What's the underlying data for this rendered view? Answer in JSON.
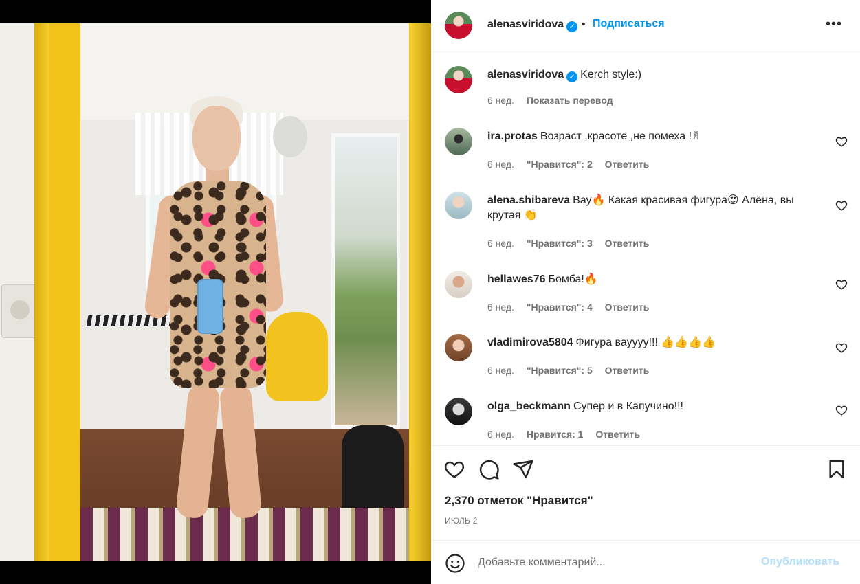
{
  "post": {
    "author": "alenasviridova",
    "follow_label": "Подписаться",
    "dot_separator": "•",
    "more_label": "•••",
    "caption": "Kerch style:)",
    "caption_time": "6 нед.",
    "translate_label": "Показать перевод"
  },
  "comments": [
    {
      "user": "ira.protas",
      "text": "Возраст ,красоте ,не помеха !✌",
      "time": "6 нед.",
      "likes": "\"Нравится\": 2",
      "reply": "Ответить"
    },
    {
      "user": "alena.shibareva",
      "text": "Вау🔥 Какая красивая фигура😍 Алёна, вы крутая 👏",
      "time": "6 нед.",
      "likes": "\"Нравится\": 3",
      "reply": "Ответить"
    },
    {
      "user": "hellawes76",
      "text": "Бомба!🔥",
      "time": "6 нед.",
      "likes": "\"Нравится\": 4",
      "reply": "Ответить"
    },
    {
      "user": "vladimirova5804",
      "text": "Фигура вауууу!!! 👍👍👍👍",
      "time": "6 нед.",
      "likes": "\"Нравится\": 5",
      "reply": "Ответить"
    },
    {
      "user": "olga_beckmann",
      "text": "Супер и в Капучино!!!",
      "time": "6 нед.",
      "likes": "Нравится: 1",
      "reply": "Ответить"
    }
  ],
  "actions": {
    "likes_count": "2,370 отметок \"Нравится\"",
    "date": "ИЮЛЬ 2"
  },
  "comment_form": {
    "placeholder": "Добавьте комментарий...",
    "publish_label": "Опубликовать"
  },
  "icons": [
    "heart-icon",
    "comment-icon",
    "share-icon",
    "bookmark-icon",
    "emoji-icon",
    "verified-icon",
    "more-icon"
  ],
  "colors": {
    "accent": "#0095f6",
    "publish_disabled": "#b2dffc",
    "frame_yellow": "#f2c21a"
  }
}
